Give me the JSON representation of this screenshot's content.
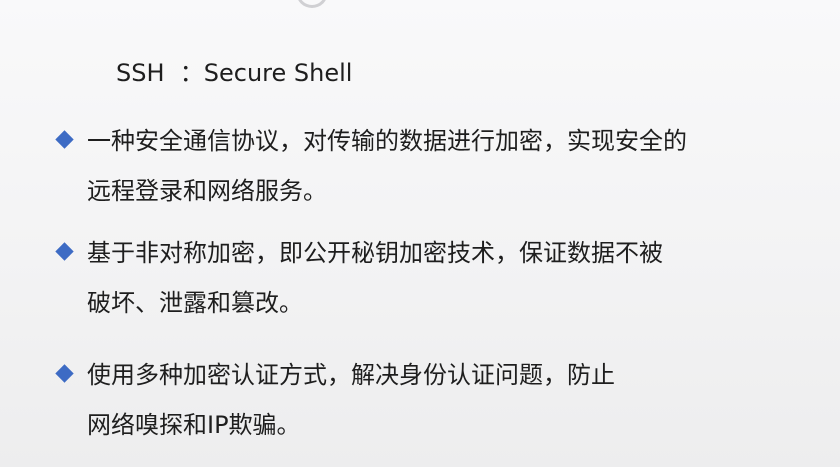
{
  "slide": {
    "title": "SSH  ：Secure Shell",
    "bullets": [
      {
        "lines": [
          "一种安全通信协议，对传输的数据进行加密，实现安全的",
          "远程登录和网络服务。"
        ]
      },
      {
        "lines": [
          "基于非对称加密，即公开秘钥加密技术，保证数据不被",
          "破坏、泄露和篡改。"
        ]
      },
      {
        "lines": [
          "使用多种加密认证方式，解决身份认证问题，防止",
          "网络嗅探和IP欺骗。"
        ]
      }
    ],
    "bullet_icon": "diamond-bullet-icon",
    "accent_color": "#3d6bc4"
  }
}
